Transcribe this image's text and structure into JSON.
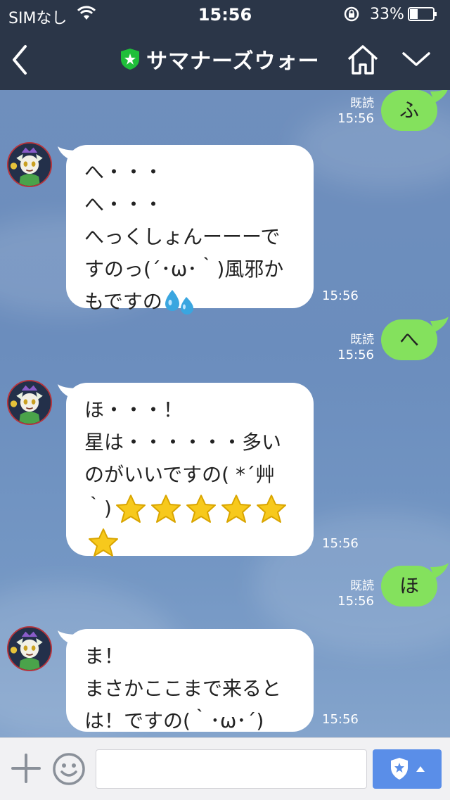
{
  "status_bar": {
    "carrier": "SIMなし",
    "time": "15:56",
    "battery": "33%",
    "battery_level": 0.33
  },
  "nav": {
    "title": "サマナーズウォー",
    "back_icon": "chevron-left-icon",
    "home_icon": "home-icon",
    "menu_icon": "chevron-down-icon"
  },
  "messages": [
    {
      "side": "out",
      "text": "ふ",
      "read": "既読",
      "time": "15:56"
    },
    {
      "side": "in",
      "lines": [
        "へ・・・",
        "へ・・・",
        "へっくしょんーーーで",
        "すのっ(´･ω･｀)風邪か",
        "もですの"
      ],
      "emoji_tail": "sweat-drops-icon",
      "time": "15:56"
    },
    {
      "side": "out",
      "text": "へ",
      "read": "既読",
      "time": "15:56"
    },
    {
      "side": "in",
      "lines": [
        "ほ・・・！",
        "星は・・・・・・多い",
        "のがいいですの( *´艸",
        "｀)"
      ],
      "emoji_tail": "star-icon",
      "star_count": 6,
      "time": "15:56"
    },
    {
      "side": "out",
      "text": "ほ",
      "read": "既読",
      "time": "15:56"
    },
    {
      "side": "in",
      "lines": [
        "ま！",
        "まさかここまで来ると",
        "は！ですの(｀･ω･´)"
      ],
      "time": "15:56"
    }
  ],
  "input": {
    "placeholder": "",
    "value": ""
  },
  "colors": {
    "header_bg": "#2b3648",
    "bubble_out": "#84e15d",
    "bubble_in": "#ffffff",
    "sticker_button": "#5a8ee8",
    "verified_shield": "#1fbf3a"
  }
}
